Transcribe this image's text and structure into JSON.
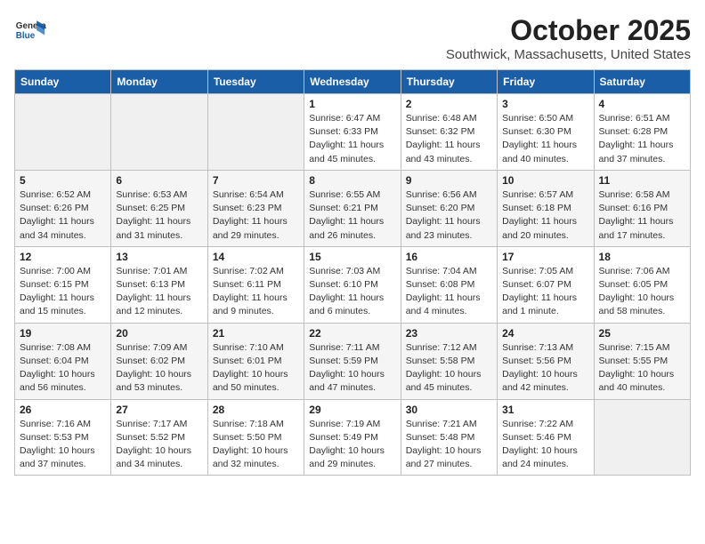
{
  "header": {
    "logo": {
      "general": "General",
      "blue": "Blue"
    },
    "title": "October 2025",
    "subtitle": "Southwick, Massachusetts, United States"
  },
  "days_of_week": [
    "Sunday",
    "Monday",
    "Tuesday",
    "Wednesday",
    "Thursday",
    "Friday",
    "Saturday"
  ],
  "weeks": [
    [
      {
        "num": "",
        "info": ""
      },
      {
        "num": "",
        "info": ""
      },
      {
        "num": "",
        "info": ""
      },
      {
        "num": "1",
        "info": "Sunrise: 6:47 AM\nSunset: 6:33 PM\nDaylight: 11 hours and 45 minutes."
      },
      {
        "num": "2",
        "info": "Sunrise: 6:48 AM\nSunset: 6:32 PM\nDaylight: 11 hours and 43 minutes."
      },
      {
        "num": "3",
        "info": "Sunrise: 6:50 AM\nSunset: 6:30 PM\nDaylight: 11 hours and 40 minutes."
      },
      {
        "num": "4",
        "info": "Sunrise: 6:51 AM\nSunset: 6:28 PM\nDaylight: 11 hours and 37 minutes."
      }
    ],
    [
      {
        "num": "5",
        "info": "Sunrise: 6:52 AM\nSunset: 6:26 PM\nDaylight: 11 hours and 34 minutes."
      },
      {
        "num": "6",
        "info": "Sunrise: 6:53 AM\nSunset: 6:25 PM\nDaylight: 11 hours and 31 minutes."
      },
      {
        "num": "7",
        "info": "Sunrise: 6:54 AM\nSunset: 6:23 PM\nDaylight: 11 hours and 29 minutes."
      },
      {
        "num": "8",
        "info": "Sunrise: 6:55 AM\nSunset: 6:21 PM\nDaylight: 11 hours and 26 minutes."
      },
      {
        "num": "9",
        "info": "Sunrise: 6:56 AM\nSunset: 6:20 PM\nDaylight: 11 hours and 23 minutes."
      },
      {
        "num": "10",
        "info": "Sunrise: 6:57 AM\nSunset: 6:18 PM\nDaylight: 11 hours and 20 minutes."
      },
      {
        "num": "11",
        "info": "Sunrise: 6:58 AM\nSunset: 6:16 PM\nDaylight: 11 hours and 17 minutes."
      }
    ],
    [
      {
        "num": "12",
        "info": "Sunrise: 7:00 AM\nSunset: 6:15 PM\nDaylight: 11 hours and 15 minutes."
      },
      {
        "num": "13",
        "info": "Sunrise: 7:01 AM\nSunset: 6:13 PM\nDaylight: 11 hours and 12 minutes."
      },
      {
        "num": "14",
        "info": "Sunrise: 7:02 AM\nSunset: 6:11 PM\nDaylight: 11 hours and 9 minutes."
      },
      {
        "num": "15",
        "info": "Sunrise: 7:03 AM\nSunset: 6:10 PM\nDaylight: 11 hours and 6 minutes."
      },
      {
        "num": "16",
        "info": "Sunrise: 7:04 AM\nSunset: 6:08 PM\nDaylight: 11 hours and 4 minutes."
      },
      {
        "num": "17",
        "info": "Sunrise: 7:05 AM\nSunset: 6:07 PM\nDaylight: 11 hours and 1 minute."
      },
      {
        "num": "18",
        "info": "Sunrise: 7:06 AM\nSunset: 6:05 PM\nDaylight: 10 hours and 58 minutes."
      }
    ],
    [
      {
        "num": "19",
        "info": "Sunrise: 7:08 AM\nSunset: 6:04 PM\nDaylight: 10 hours and 56 minutes."
      },
      {
        "num": "20",
        "info": "Sunrise: 7:09 AM\nSunset: 6:02 PM\nDaylight: 10 hours and 53 minutes."
      },
      {
        "num": "21",
        "info": "Sunrise: 7:10 AM\nSunset: 6:01 PM\nDaylight: 10 hours and 50 minutes."
      },
      {
        "num": "22",
        "info": "Sunrise: 7:11 AM\nSunset: 5:59 PM\nDaylight: 10 hours and 47 minutes."
      },
      {
        "num": "23",
        "info": "Sunrise: 7:12 AM\nSunset: 5:58 PM\nDaylight: 10 hours and 45 minutes."
      },
      {
        "num": "24",
        "info": "Sunrise: 7:13 AM\nSunset: 5:56 PM\nDaylight: 10 hours and 42 minutes."
      },
      {
        "num": "25",
        "info": "Sunrise: 7:15 AM\nSunset: 5:55 PM\nDaylight: 10 hours and 40 minutes."
      }
    ],
    [
      {
        "num": "26",
        "info": "Sunrise: 7:16 AM\nSunset: 5:53 PM\nDaylight: 10 hours and 37 minutes."
      },
      {
        "num": "27",
        "info": "Sunrise: 7:17 AM\nSunset: 5:52 PM\nDaylight: 10 hours and 34 minutes."
      },
      {
        "num": "28",
        "info": "Sunrise: 7:18 AM\nSunset: 5:50 PM\nDaylight: 10 hours and 32 minutes."
      },
      {
        "num": "29",
        "info": "Sunrise: 7:19 AM\nSunset: 5:49 PM\nDaylight: 10 hours and 29 minutes."
      },
      {
        "num": "30",
        "info": "Sunrise: 7:21 AM\nSunset: 5:48 PM\nDaylight: 10 hours and 27 minutes."
      },
      {
        "num": "31",
        "info": "Sunrise: 7:22 AM\nSunset: 5:46 PM\nDaylight: 10 hours and 24 minutes."
      },
      {
        "num": "",
        "info": ""
      }
    ]
  ]
}
